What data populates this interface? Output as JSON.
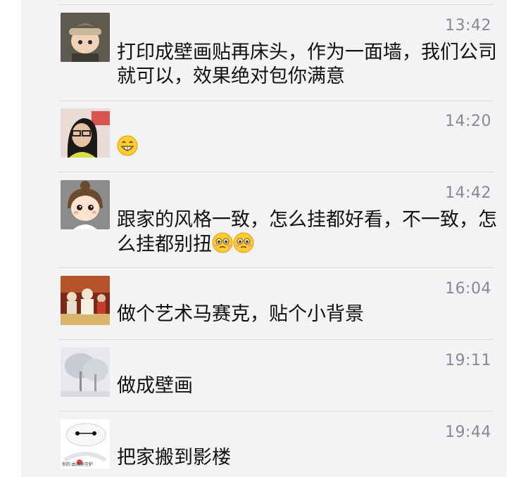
{
  "comments": [
    {
      "avatar": "boy-helmet-avatar",
      "time": "13:42",
      "text": "打印成壁画贴再床头，作为一面墙，我们公司就可以，效果绝对包你满意",
      "emoji": []
    },
    {
      "avatar": "woman-glasses-avatar",
      "time": "14:20",
      "text": "",
      "emoji": [
        "grin-emoji"
      ]
    },
    {
      "avatar": "cartoon-girl-avatar",
      "time": "14:42",
      "text": "跟家的风格一致，怎么挂都好看，不一致，怎么挂都别扭",
      "emoji": [
        "pleading-emoji",
        "pleading-emoji"
      ]
    },
    {
      "avatar": "figurines-avatar",
      "time": "16:04",
      "text": "做个艺术马赛克，贴个小背景",
      "emoji": []
    },
    {
      "avatar": "snowy-tree-avatar",
      "time": "19:11",
      "text": "做成壁画",
      "emoji": []
    },
    {
      "avatar": "baymax-avatar",
      "time": "19:44",
      "text": "把家搬到影楼",
      "emoji": []
    }
  ],
  "avatar_captions": {
    "baymax": "你的 由我来守护"
  }
}
